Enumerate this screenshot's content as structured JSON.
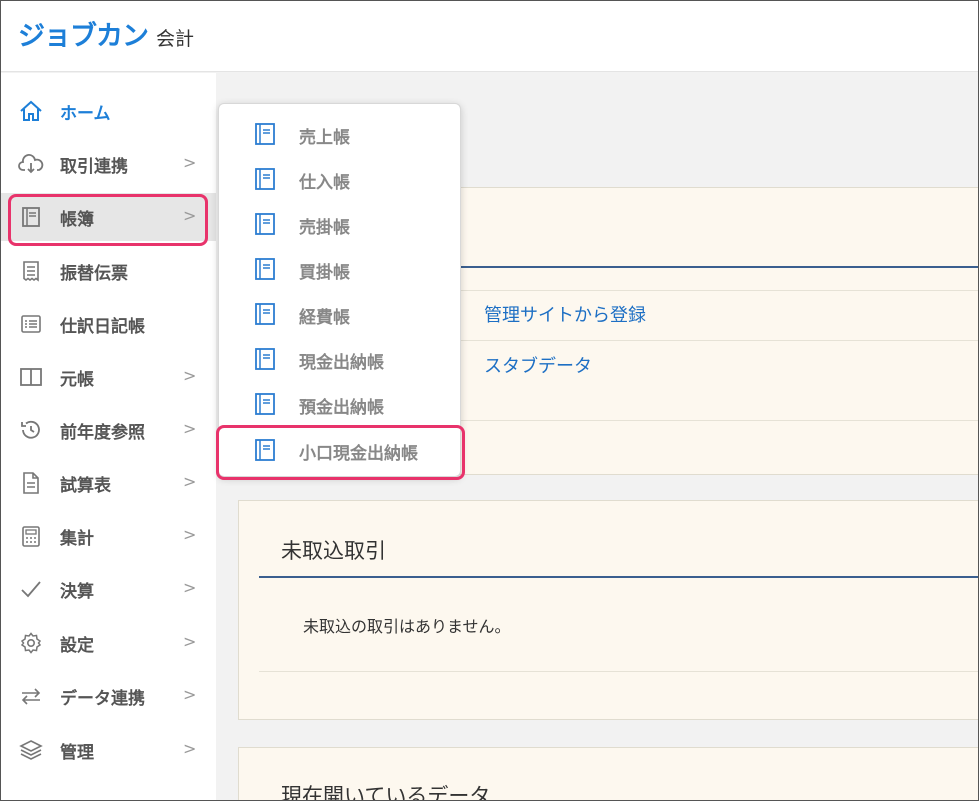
{
  "header": {
    "logo_main": "ジョブカン",
    "logo_sub": "会計"
  },
  "sidebar": {
    "items": [
      {
        "label": "ホーム",
        "icon": "home-icon",
        "chevron": ""
      },
      {
        "label": "取引連携",
        "icon": "cloud-download-icon",
        "chevron": ">"
      },
      {
        "label": "帳簿",
        "icon": "book-icon",
        "chevron": ">"
      },
      {
        "label": "振替伝票",
        "icon": "receipt-icon",
        "chevron": ""
      },
      {
        "label": "仕訳日記帳",
        "icon": "list-icon",
        "chevron": ""
      },
      {
        "label": "元帳",
        "icon": "columns-icon",
        "chevron": ">"
      },
      {
        "label": "前年度参照",
        "icon": "history-icon",
        "chevron": ">"
      },
      {
        "label": "試算表",
        "icon": "document-icon",
        "chevron": ">"
      },
      {
        "label": "集計",
        "icon": "calculator-icon",
        "chevron": ">"
      },
      {
        "label": "決算",
        "icon": "check-icon",
        "chevron": ">"
      },
      {
        "label": "設定",
        "icon": "gear-icon",
        "chevron": ">"
      },
      {
        "label": "データ連携",
        "icon": "swap-arrows-icon",
        "chevron": ">"
      },
      {
        "label": "管理",
        "icon": "layers-icon",
        "chevron": ">"
      }
    ]
  },
  "dropdown": {
    "items": [
      {
        "label": "売上帳"
      },
      {
        "label": "仕入帳"
      },
      {
        "label": "売掛帳"
      },
      {
        "label": "買掛帳"
      },
      {
        "label": "経費帳"
      },
      {
        "label": "現金出納帳"
      },
      {
        "label": "預金出納帳"
      },
      {
        "label": "小口現金出納帳"
      }
    ]
  },
  "main": {
    "card1": {
      "link1": "管理サイトから登録",
      "link2": "スタブデータ"
    },
    "card2": {
      "title": "未取込取引",
      "message": "未取込の取引はありません。"
    },
    "card3": {
      "title": "現在開いているデータ"
    }
  },
  "colors": {
    "brand": "#1d7fd8",
    "highlight": "#e8336b",
    "card_bg": "#fdf8ef"
  }
}
